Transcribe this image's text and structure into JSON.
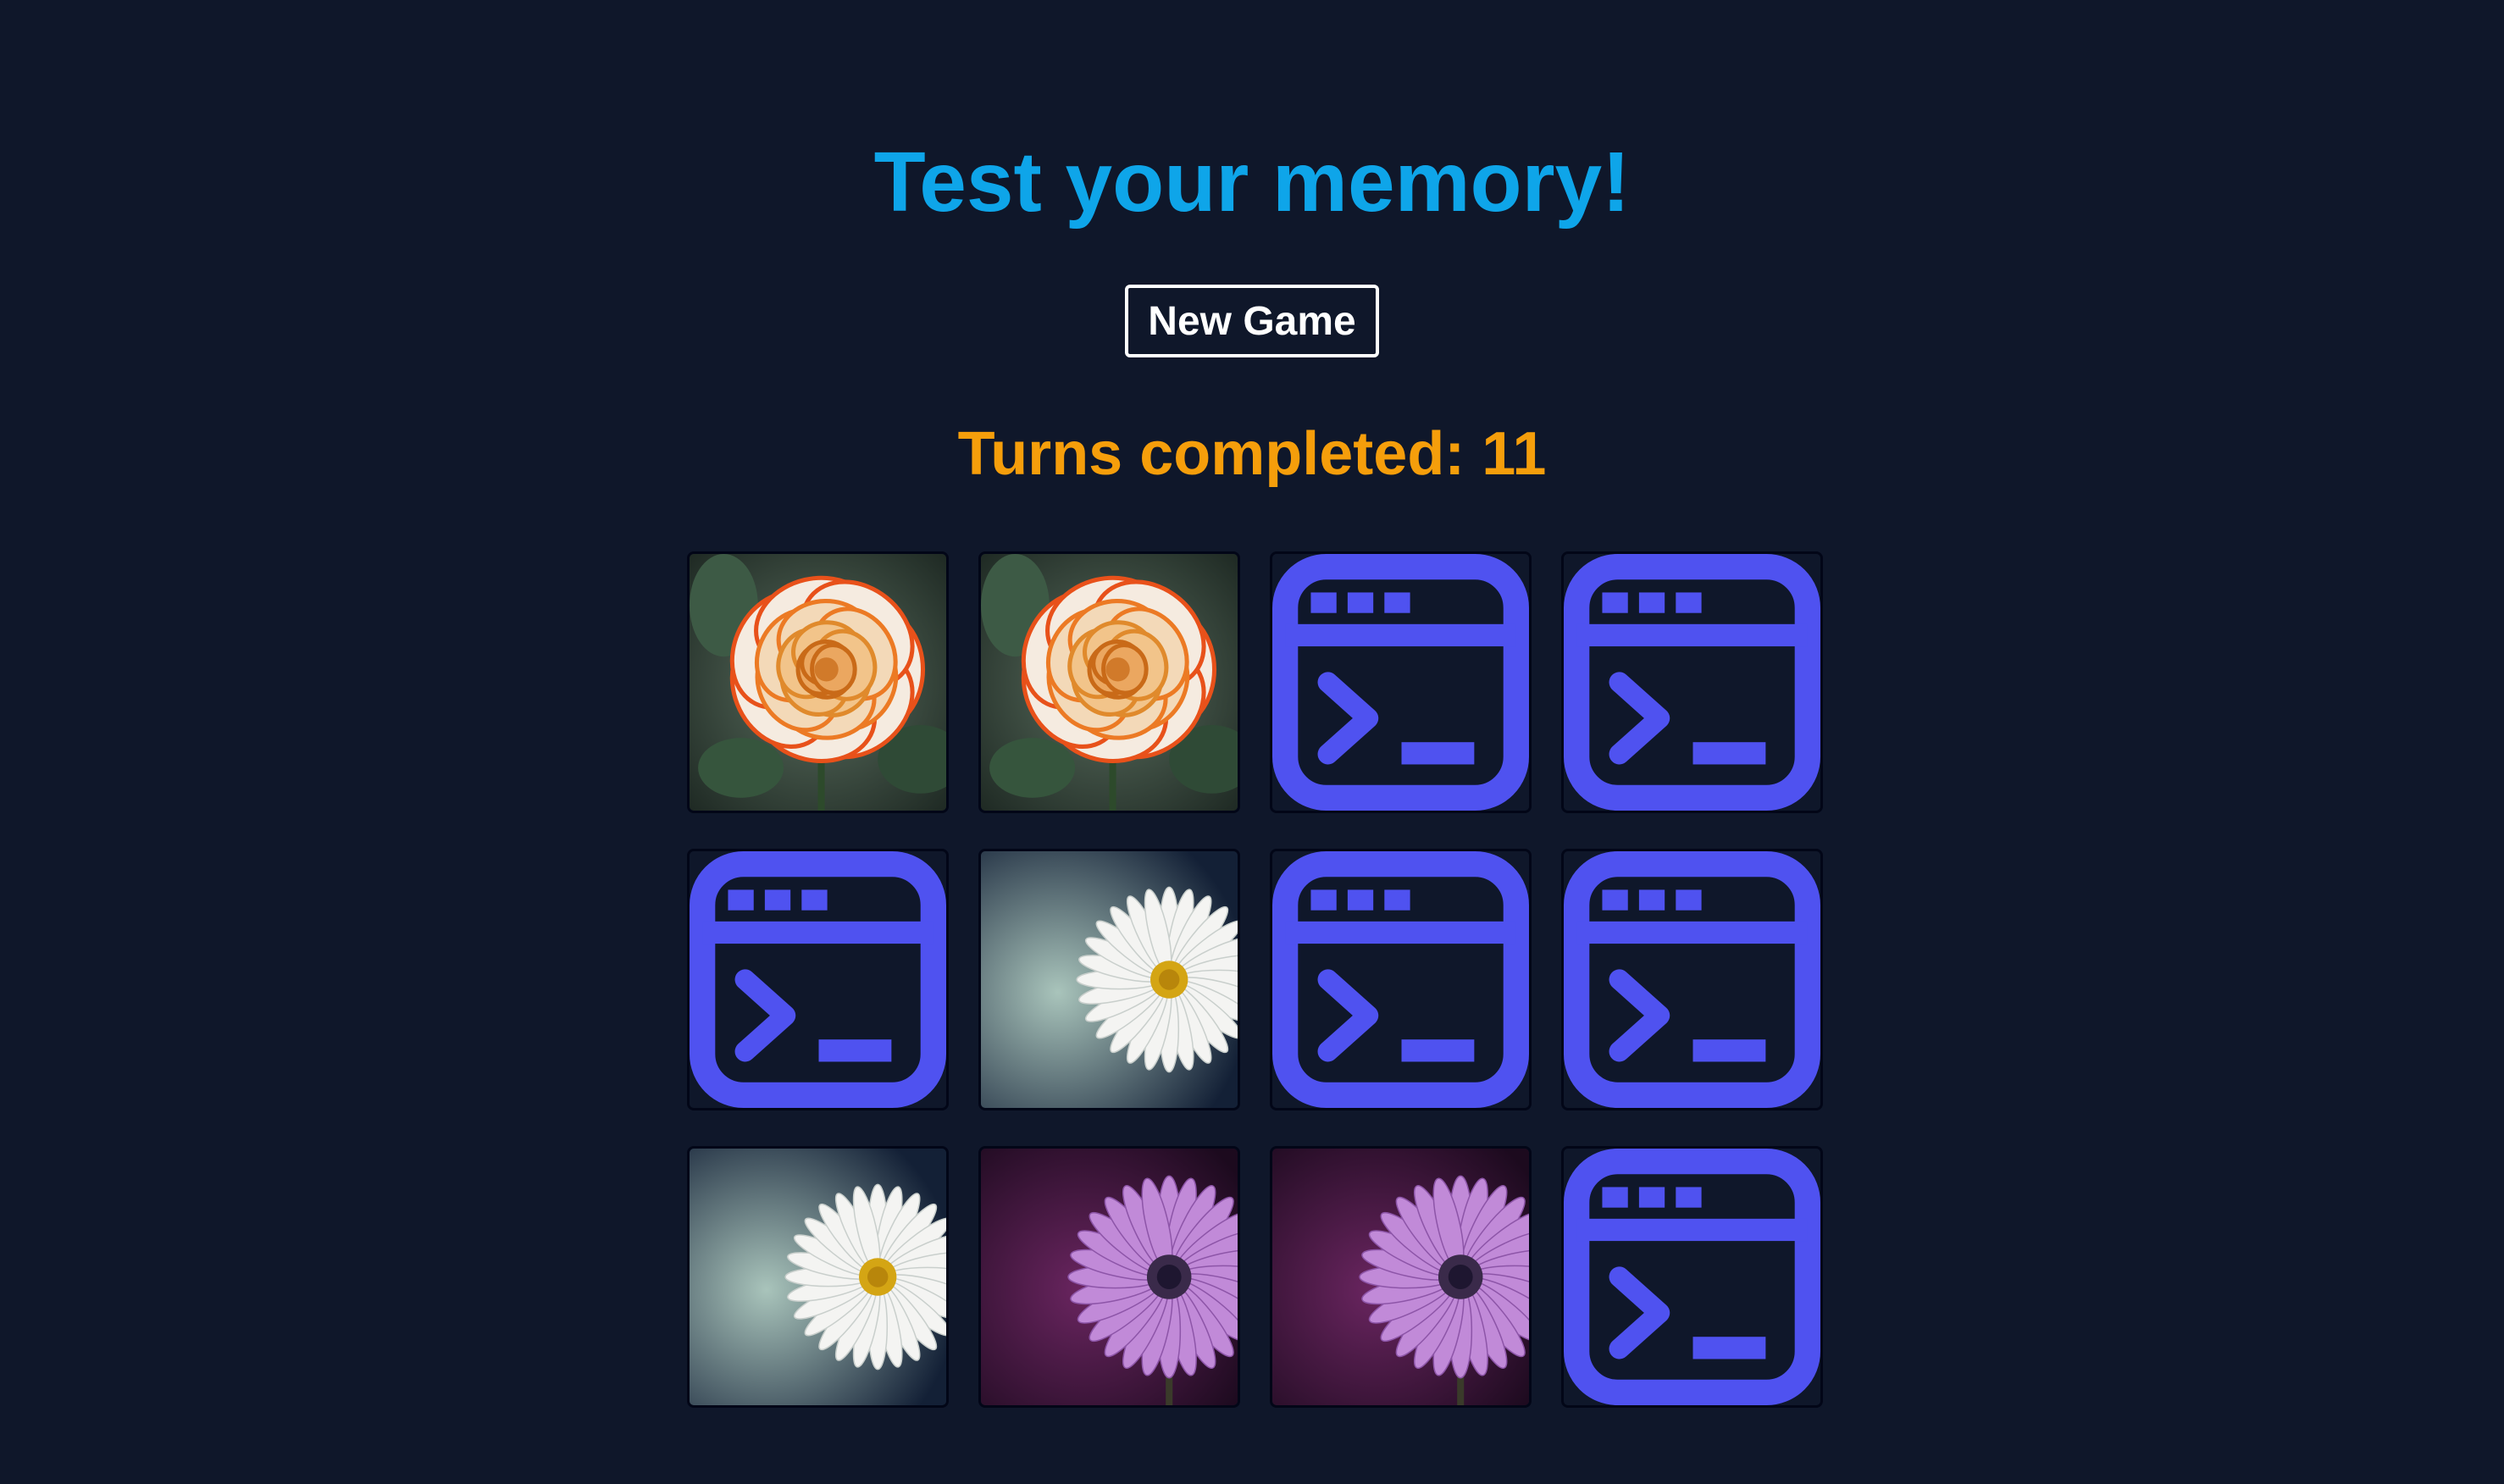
{
  "title": "Test your memory!",
  "new_game_label": "New Game",
  "turns_label": "Turns completed:",
  "turns_value": "11",
  "colors": {
    "background": "#0f172a",
    "title": "#0ea5e9",
    "turns": "#f59e0b",
    "card_back_icon": "#4f52f0"
  },
  "cards": [
    {
      "state": "face-up",
      "face": "rose"
    },
    {
      "state": "face-up",
      "face": "rose"
    },
    {
      "state": "face-down",
      "face": "terminal-icon"
    },
    {
      "state": "face-down",
      "face": "terminal-icon"
    },
    {
      "state": "face-down",
      "face": "terminal-icon"
    },
    {
      "state": "face-up",
      "face": "white-daisy"
    },
    {
      "state": "face-down",
      "face": "terminal-icon"
    },
    {
      "state": "face-down",
      "face": "terminal-icon"
    },
    {
      "state": "face-up",
      "face": "white-daisy"
    },
    {
      "state": "face-up",
      "face": "purple-daisy"
    },
    {
      "state": "face-up",
      "face": "purple-daisy"
    },
    {
      "state": "face-down",
      "face": "terminal-icon"
    }
  ]
}
